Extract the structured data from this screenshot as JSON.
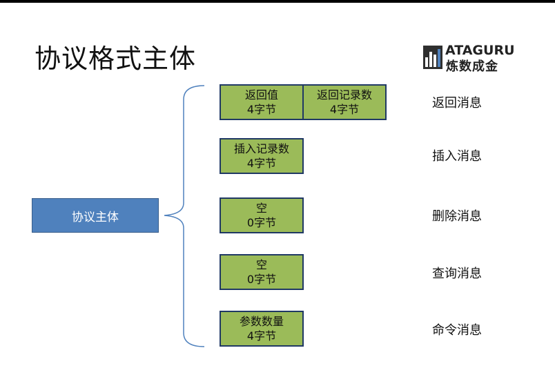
{
  "title": "协议格式主体",
  "logo": {
    "line1": "ATAGURU",
    "line2": "炼数成金"
  },
  "main_box": {
    "label": "协议主体"
  },
  "rows": [
    {
      "boxes": [
        {
          "name": "返回值",
          "size": "4字节"
        },
        {
          "name": "返回记录数",
          "size": "4字节"
        }
      ],
      "message": "返回消息"
    },
    {
      "boxes": [
        {
          "name": "插入记录数",
          "size": "4字节"
        }
      ],
      "message": "插入消息"
    },
    {
      "boxes": [
        {
          "name": "空",
          "size": "0字节"
        }
      ],
      "message": "删除消息"
    },
    {
      "boxes": [
        {
          "name": "空",
          "size": "0字节"
        }
      ],
      "message": "查询消息"
    },
    {
      "boxes": [
        {
          "name": "参数数量",
          "size": "4字节"
        }
      ],
      "message": "命令消息"
    }
  ],
  "colors": {
    "main_box": "#4f81bd",
    "field_box": "#9bbb59",
    "field_border": "#1f3864",
    "brace": "#4f81bd"
  }
}
